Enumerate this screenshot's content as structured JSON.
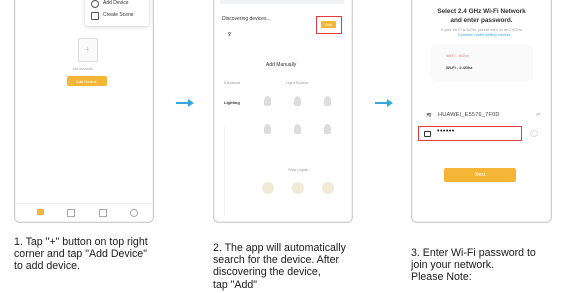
{
  "step1": {
    "menu_add_device": "Add Device",
    "menu_create_scene": "Create Scene",
    "no_devices": "No devices",
    "add_device_button": "Add Device",
    "caption": [
      "1. Tap \"+\" button on top right",
      "corner and tap \"Add Device\"",
      "to add device."
    ]
  },
  "step2": {
    "discovering": "Discovering devices...",
    "add_button": "Add",
    "add_manually": "Add Manually",
    "cat_electrical": "Electrical",
    "cat_lighting": "Lighting",
    "sub_light_source": "Light Source",
    "sub_strip_lights": "Strip Lights",
    "caption": [
      "2. The app will automatically",
      "search for the device. After",
      "discovering the device,",
      "tap \"Add\""
    ]
  },
  "step3": {
    "title_line1": "Select 2.4 GHz Wi-Fi Network",
    "title_line2": "and enter password.",
    "hint": "If your Wi-Fi is 5GHz, please set it to be 2.4GHz.",
    "hint_link": "Common router setting method",
    "wifi_5g": "Wi-Fi - 5Ghz",
    "wifi_24g": "Wi-Fi - 2.4Ghz",
    "network_name": "HUAWEI_E5576_7F0D",
    "password_mask": "••••••",
    "next_button": "Next",
    "caption": [
      "3. Enter Wi-Fi password to",
      "join your network.",
      "Please Note:"
    ]
  },
  "colors": {
    "accent": "#f5b638",
    "highlight": "#e0393e",
    "arrow": "#33a8e0"
  }
}
